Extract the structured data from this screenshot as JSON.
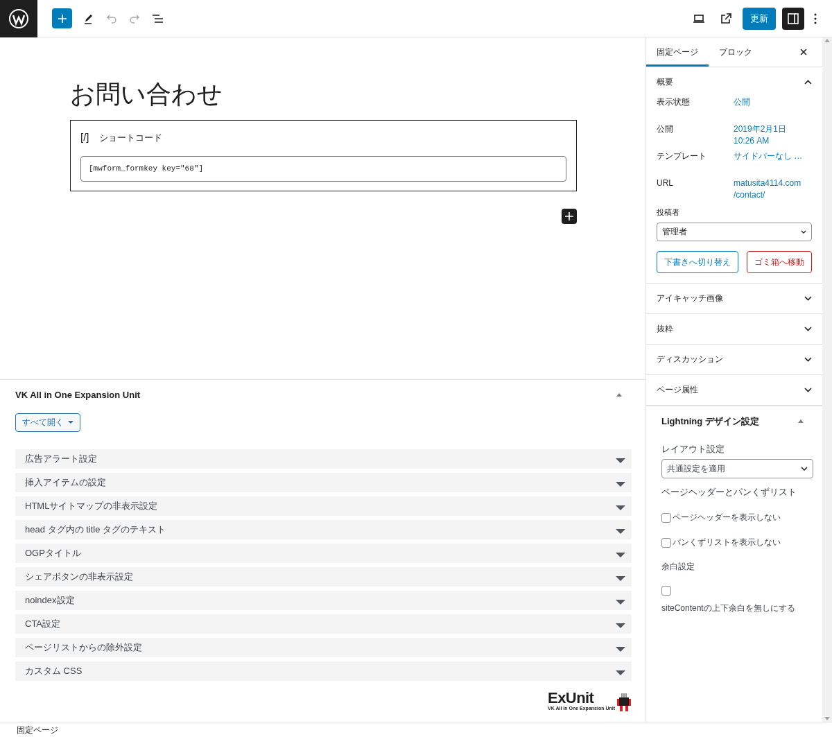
{
  "toolbar": {
    "update_button": "更新",
    "undo_disabled": true,
    "redo_disabled": true
  },
  "document": {
    "title": "お問い合わせ",
    "block": {
      "icon_text": "[/]",
      "label": "ショートコード",
      "value": "[mwform_formkey key=\"68\"]"
    }
  },
  "meta_box": {
    "title": "VK All in One Expansion Unit",
    "expanded": true,
    "expand_button": "すべて開く",
    "items": [
      {
        "label": "広告アラート設定",
        "expanded": false
      },
      {
        "label": "挿入アイテムの設定",
        "expanded": false
      },
      {
        "label": "HTMLサイトマップの非表示設定",
        "expanded": false
      },
      {
        "label": "head タグ内の title タグのテキスト",
        "expanded": false
      },
      {
        "label": "OGPタイトル",
        "expanded": false
      },
      {
        "label": "シェアボタンの非表示設定",
        "expanded": false
      },
      {
        "label": "noindex設定",
        "expanded": false
      },
      {
        "label": "CTA設定",
        "expanded": false
      },
      {
        "label": "ページリストからの除外設定",
        "expanded": false
      },
      {
        "label": "カスタム CSS",
        "expanded": false
      }
    ],
    "logo": {
      "name": "ExUnit",
      "tagline": "VK All in One Expansion Unit"
    }
  },
  "sidebar": {
    "tabs": [
      {
        "label": "固定ページ",
        "selected": true
      },
      {
        "label": "ブロック",
        "selected": false
      }
    ],
    "summary": {
      "title": "概要",
      "expanded": true,
      "rows": [
        {
          "label": "表示状態",
          "value": "公開"
        },
        {
          "label": "公開",
          "value": "2019年2月1日 10:26 AM"
        },
        {
          "label": "テンプレート",
          "value": "サイドバーなし …"
        },
        {
          "label": "URL",
          "value": "matusita4114.com/contact/"
        }
      ],
      "author_label": "投稿者",
      "author_value": "管理者",
      "buttons": [
        {
          "label": "下書きへ切り替え",
          "kind": "primary"
        },
        {
          "label": "ゴミ箱へ移動",
          "kind": "danger"
        }
      ]
    },
    "panels": [
      {
        "title": "アイキャッチ画像",
        "expanded": false
      },
      {
        "title": "抜粋",
        "expanded": false
      },
      {
        "title": "ディスカッション",
        "expanded": false
      },
      {
        "title": "ページ属性",
        "expanded": false
      }
    ],
    "lightning": {
      "title": "Lightning デザイン設定",
      "expanded": true,
      "layout_label": "レイアウト設定",
      "layout_value": "共通設定を適用",
      "header_label": "ページヘッダーとパンくずリスト",
      "options": [
        {
          "label": "ページヘッダーを表示しない",
          "checked": false
        },
        {
          "label": "パンくずリストを表示しない",
          "checked": false
        }
      ],
      "spacing_label": "余白設定",
      "spacing_option": {
        "label": "siteContentの上下余白を無しにする",
        "checked": false
      }
    }
  },
  "status_bar": "固定ページ"
}
